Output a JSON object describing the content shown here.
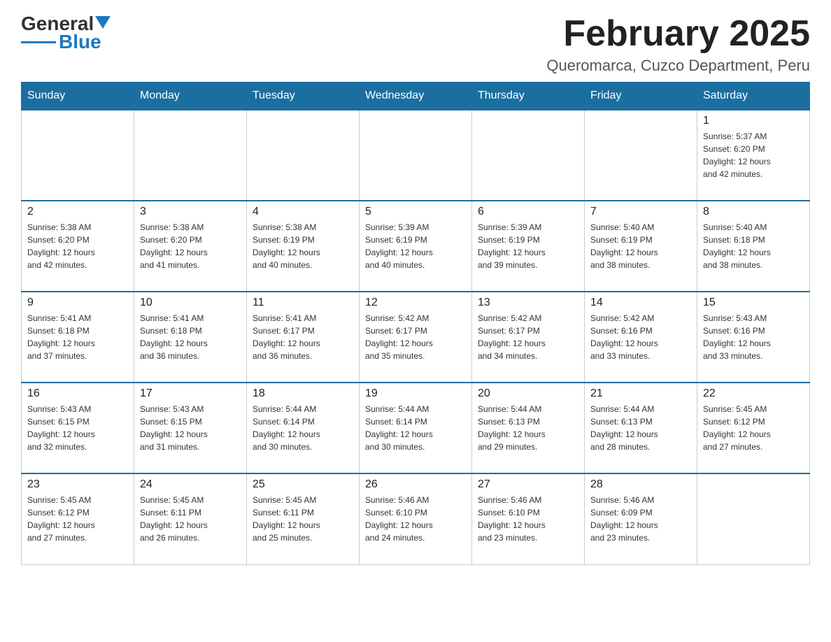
{
  "logo": {
    "text_general": "General",
    "text_blue": "Blue"
  },
  "title": "February 2025",
  "subtitle": "Queromarca, Cuzco Department, Peru",
  "days_of_week": [
    "Sunday",
    "Monday",
    "Tuesday",
    "Wednesday",
    "Thursday",
    "Friday",
    "Saturday"
  ],
  "weeks": [
    [
      {
        "day": "",
        "info": ""
      },
      {
        "day": "",
        "info": ""
      },
      {
        "day": "",
        "info": ""
      },
      {
        "day": "",
        "info": ""
      },
      {
        "day": "",
        "info": ""
      },
      {
        "day": "",
        "info": ""
      },
      {
        "day": "1",
        "info": "Sunrise: 5:37 AM\nSunset: 6:20 PM\nDaylight: 12 hours\nand 42 minutes."
      }
    ],
    [
      {
        "day": "2",
        "info": "Sunrise: 5:38 AM\nSunset: 6:20 PM\nDaylight: 12 hours\nand 42 minutes."
      },
      {
        "day": "3",
        "info": "Sunrise: 5:38 AM\nSunset: 6:20 PM\nDaylight: 12 hours\nand 41 minutes."
      },
      {
        "day": "4",
        "info": "Sunrise: 5:38 AM\nSunset: 6:19 PM\nDaylight: 12 hours\nand 40 minutes."
      },
      {
        "day": "5",
        "info": "Sunrise: 5:39 AM\nSunset: 6:19 PM\nDaylight: 12 hours\nand 40 minutes."
      },
      {
        "day": "6",
        "info": "Sunrise: 5:39 AM\nSunset: 6:19 PM\nDaylight: 12 hours\nand 39 minutes."
      },
      {
        "day": "7",
        "info": "Sunrise: 5:40 AM\nSunset: 6:19 PM\nDaylight: 12 hours\nand 38 minutes."
      },
      {
        "day": "8",
        "info": "Sunrise: 5:40 AM\nSunset: 6:18 PM\nDaylight: 12 hours\nand 38 minutes."
      }
    ],
    [
      {
        "day": "9",
        "info": "Sunrise: 5:41 AM\nSunset: 6:18 PM\nDaylight: 12 hours\nand 37 minutes."
      },
      {
        "day": "10",
        "info": "Sunrise: 5:41 AM\nSunset: 6:18 PM\nDaylight: 12 hours\nand 36 minutes."
      },
      {
        "day": "11",
        "info": "Sunrise: 5:41 AM\nSunset: 6:17 PM\nDaylight: 12 hours\nand 36 minutes."
      },
      {
        "day": "12",
        "info": "Sunrise: 5:42 AM\nSunset: 6:17 PM\nDaylight: 12 hours\nand 35 minutes."
      },
      {
        "day": "13",
        "info": "Sunrise: 5:42 AM\nSunset: 6:17 PM\nDaylight: 12 hours\nand 34 minutes."
      },
      {
        "day": "14",
        "info": "Sunrise: 5:42 AM\nSunset: 6:16 PM\nDaylight: 12 hours\nand 33 minutes."
      },
      {
        "day": "15",
        "info": "Sunrise: 5:43 AM\nSunset: 6:16 PM\nDaylight: 12 hours\nand 33 minutes."
      }
    ],
    [
      {
        "day": "16",
        "info": "Sunrise: 5:43 AM\nSunset: 6:15 PM\nDaylight: 12 hours\nand 32 minutes."
      },
      {
        "day": "17",
        "info": "Sunrise: 5:43 AM\nSunset: 6:15 PM\nDaylight: 12 hours\nand 31 minutes."
      },
      {
        "day": "18",
        "info": "Sunrise: 5:44 AM\nSunset: 6:14 PM\nDaylight: 12 hours\nand 30 minutes."
      },
      {
        "day": "19",
        "info": "Sunrise: 5:44 AM\nSunset: 6:14 PM\nDaylight: 12 hours\nand 30 minutes."
      },
      {
        "day": "20",
        "info": "Sunrise: 5:44 AM\nSunset: 6:13 PM\nDaylight: 12 hours\nand 29 minutes."
      },
      {
        "day": "21",
        "info": "Sunrise: 5:44 AM\nSunset: 6:13 PM\nDaylight: 12 hours\nand 28 minutes."
      },
      {
        "day": "22",
        "info": "Sunrise: 5:45 AM\nSunset: 6:12 PM\nDaylight: 12 hours\nand 27 minutes."
      }
    ],
    [
      {
        "day": "23",
        "info": "Sunrise: 5:45 AM\nSunset: 6:12 PM\nDaylight: 12 hours\nand 27 minutes."
      },
      {
        "day": "24",
        "info": "Sunrise: 5:45 AM\nSunset: 6:11 PM\nDaylight: 12 hours\nand 26 minutes."
      },
      {
        "day": "25",
        "info": "Sunrise: 5:45 AM\nSunset: 6:11 PM\nDaylight: 12 hours\nand 25 minutes."
      },
      {
        "day": "26",
        "info": "Sunrise: 5:46 AM\nSunset: 6:10 PM\nDaylight: 12 hours\nand 24 minutes."
      },
      {
        "day": "27",
        "info": "Sunrise: 5:46 AM\nSunset: 6:10 PM\nDaylight: 12 hours\nand 23 minutes."
      },
      {
        "day": "28",
        "info": "Sunrise: 5:46 AM\nSunset: 6:09 PM\nDaylight: 12 hours\nand 23 minutes."
      },
      {
        "day": "",
        "info": ""
      }
    ]
  ]
}
